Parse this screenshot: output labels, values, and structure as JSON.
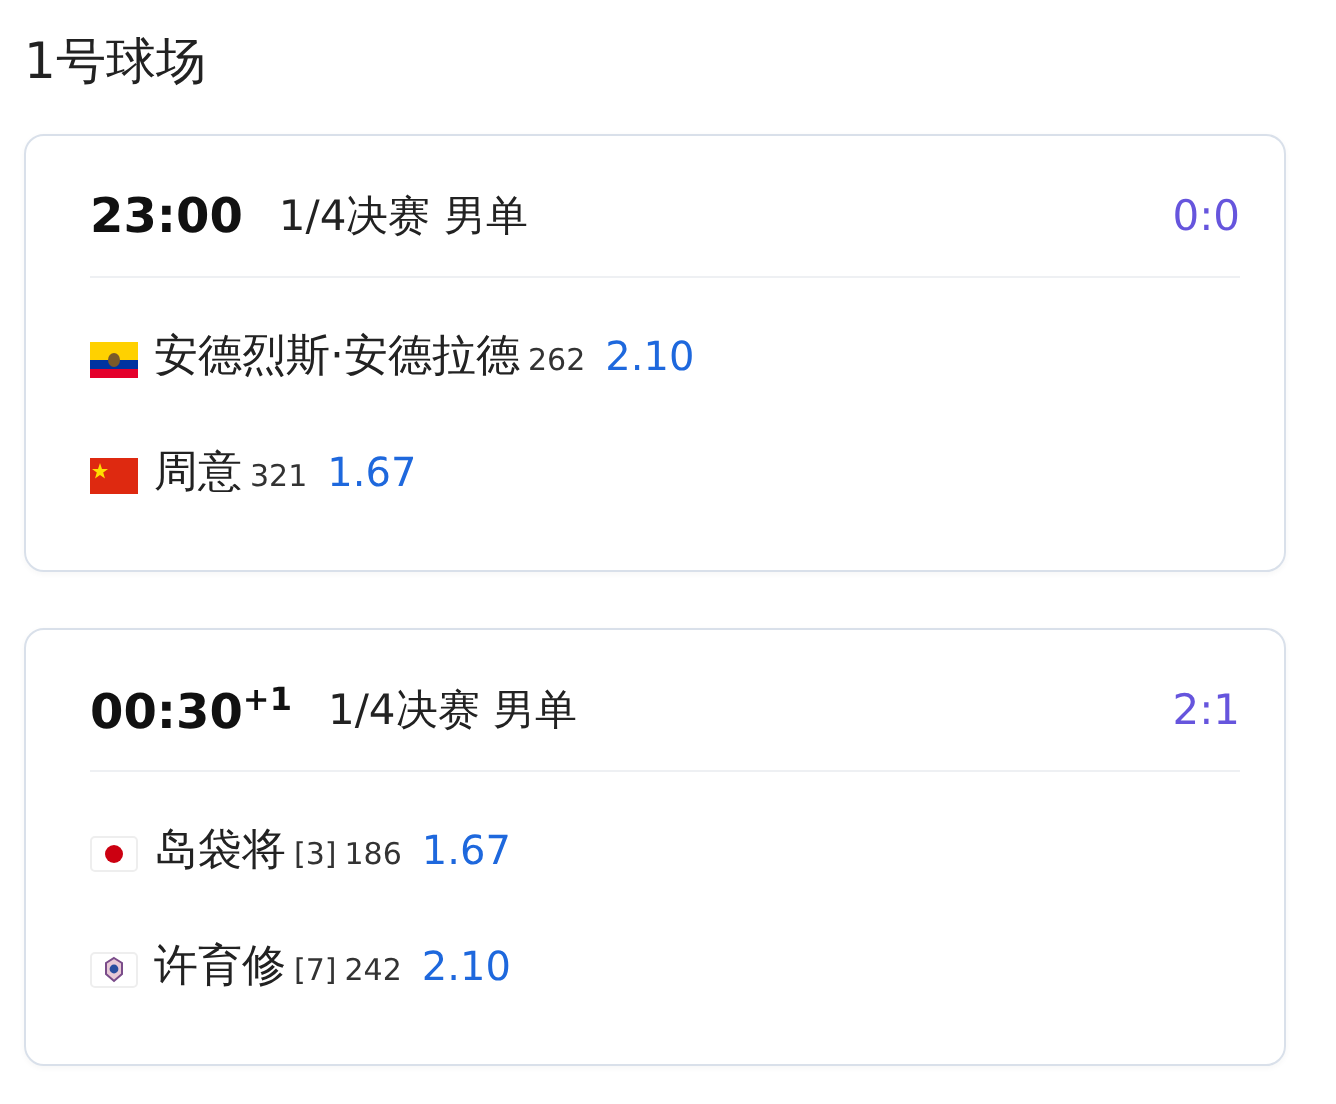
{
  "title": "1号球场",
  "matches": [
    {
      "time": "23:00",
      "round": "1/4决赛 男单",
      "score": "0:0",
      "players": [
        {
          "kind": "ec",
          "name": "安德烈斯·安德拉德",
          "rank": "262",
          "odds": "2.10"
        },
        {
          "kind": "cn",
          "name": "周意",
          "rank": "321",
          "odds": "1.67"
        }
      ]
    },
    {
      "time": "00:30",
      "day_offset": "+1",
      "round": "1/4决赛 男单",
      "score": "2:1",
      "players": [
        {
          "kind": "jp",
          "name": "岛袋将",
          "seed": "[3]",
          "rank": "186",
          "odds": "1.67"
        },
        {
          "kind": "tpe",
          "name": "许育修",
          "seed": "[7]",
          "rank": "242",
          "odds": "2.10"
        }
      ]
    }
  ]
}
